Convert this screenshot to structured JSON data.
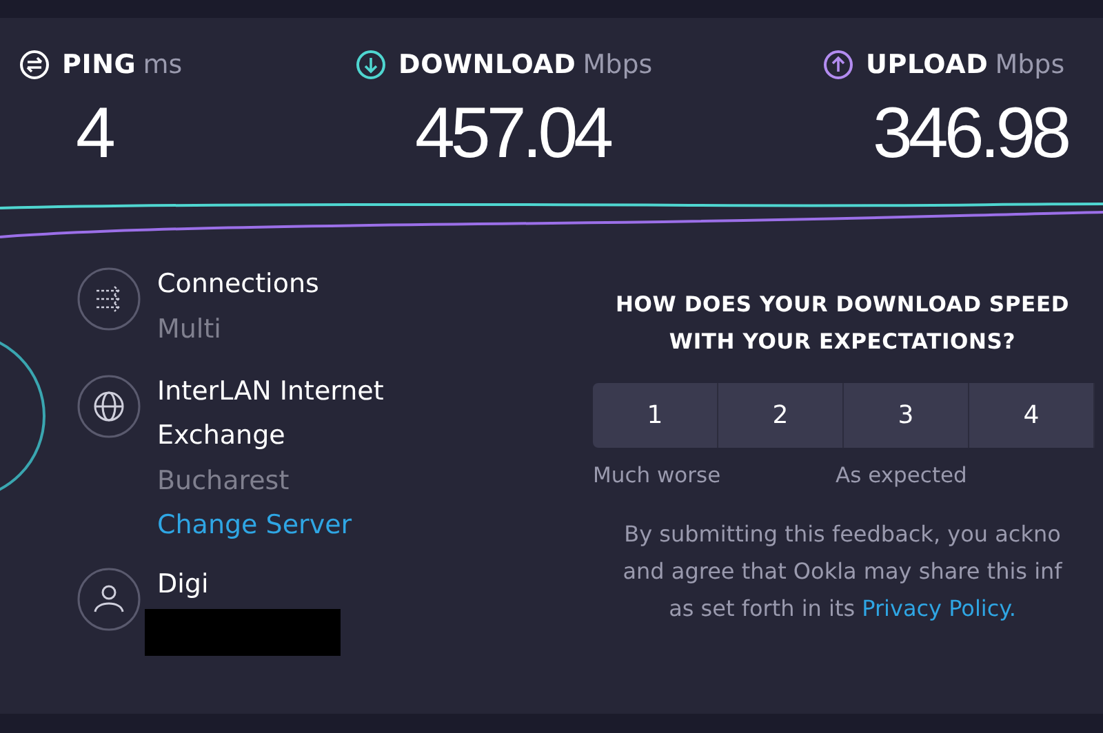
{
  "metrics": [
    {
      "kind": "ping",
      "label": "PING",
      "unit": "ms",
      "value": "4"
    },
    {
      "kind": "download",
      "label": "DOWNLOAD",
      "unit": "Mbps",
      "value": "457.04"
    },
    {
      "kind": "upload",
      "label": "UPLOAD",
      "unit": "Mbps",
      "value": "346.98"
    }
  ],
  "info": [
    {
      "kind": "connections",
      "title": [
        "Connections"
      ],
      "detail": "Multi"
    },
    {
      "kind": "server",
      "title": [
        "InterLAN Internet",
        "Exchange"
      ],
      "detail": "Bucharest",
      "link": "Change Server"
    },
    {
      "kind": "provider",
      "title": [
        "Digi"
      ],
      "redacted": true
    }
  ],
  "feedback": {
    "question": [
      "HOW DOES YOUR DOWNLOAD SPEED",
      "WITH YOUR EXPECTATIONS?"
    ],
    "ratings": [
      "1",
      "2",
      "3",
      "4"
    ],
    "scale_labels": {
      "low": "Much worse",
      "middle": "As expected"
    },
    "notice": [
      "By submitting this feedback, you ackno",
      "and agree that Ookla may share this inf"
    ],
    "notice_last": "as set forth in its",
    "policy_link": "Privacy Policy."
  }
}
